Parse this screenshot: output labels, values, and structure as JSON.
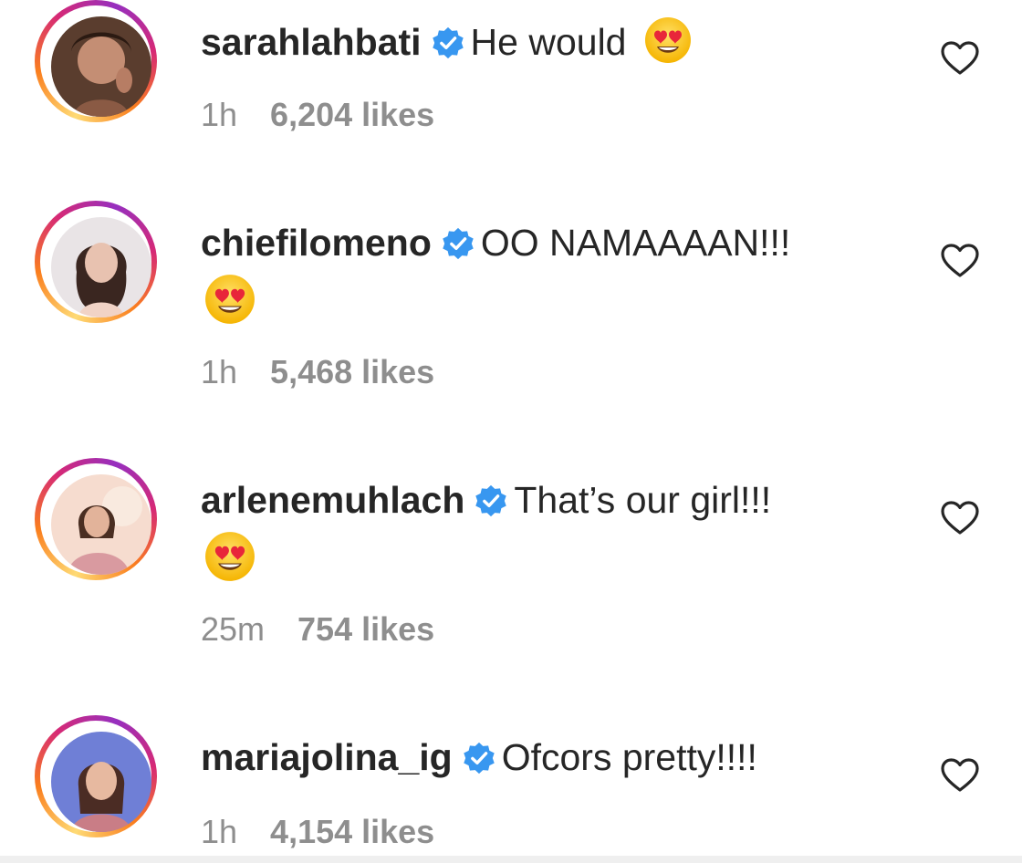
{
  "comments": [
    {
      "username": "sarahlahbati",
      "text": "He would",
      "time": "1h",
      "likes": "6,204 likes",
      "avatar_icon": "user-avatar-photo",
      "emoji": "heart-eyes-emoji"
    },
    {
      "username": "chiefilomeno",
      "text": "OO NAMAAAAN!!!",
      "time": "1h",
      "likes": "5,468 likes",
      "avatar_icon": "user-avatar-photo",
      "emoji": "heart-eyes-emoji"
    },
    {
      "username": "arlenemuhlach",
      "text": "That’s our girl!!!",
      "time": "25m",
      "likes": "754 likes",
      "avatar_icon": "user-avatar-photo",
      "emoji": "heart-eyes-emoji"
    },
    {
      "username": "mariajolina_ig",
      "text": "Ofcors pretty!!!!",
      "time": "1h",
      "likes": "4,154 likes",
      "avatar_icon": "user-avatar-photo"
    }
  ],
  "colors": {
    "verified_blue": "#3897f0",
    "meta_gray": "#8e8e8e",
    "text": "#262626",
    "story_ring_start": "#feda75",
    "story_ring_end": "#d62976"
  },
  "icons": {
    "verified": "verified-badge-icon",
    "like": "heart-outline-icon"
  }
}
